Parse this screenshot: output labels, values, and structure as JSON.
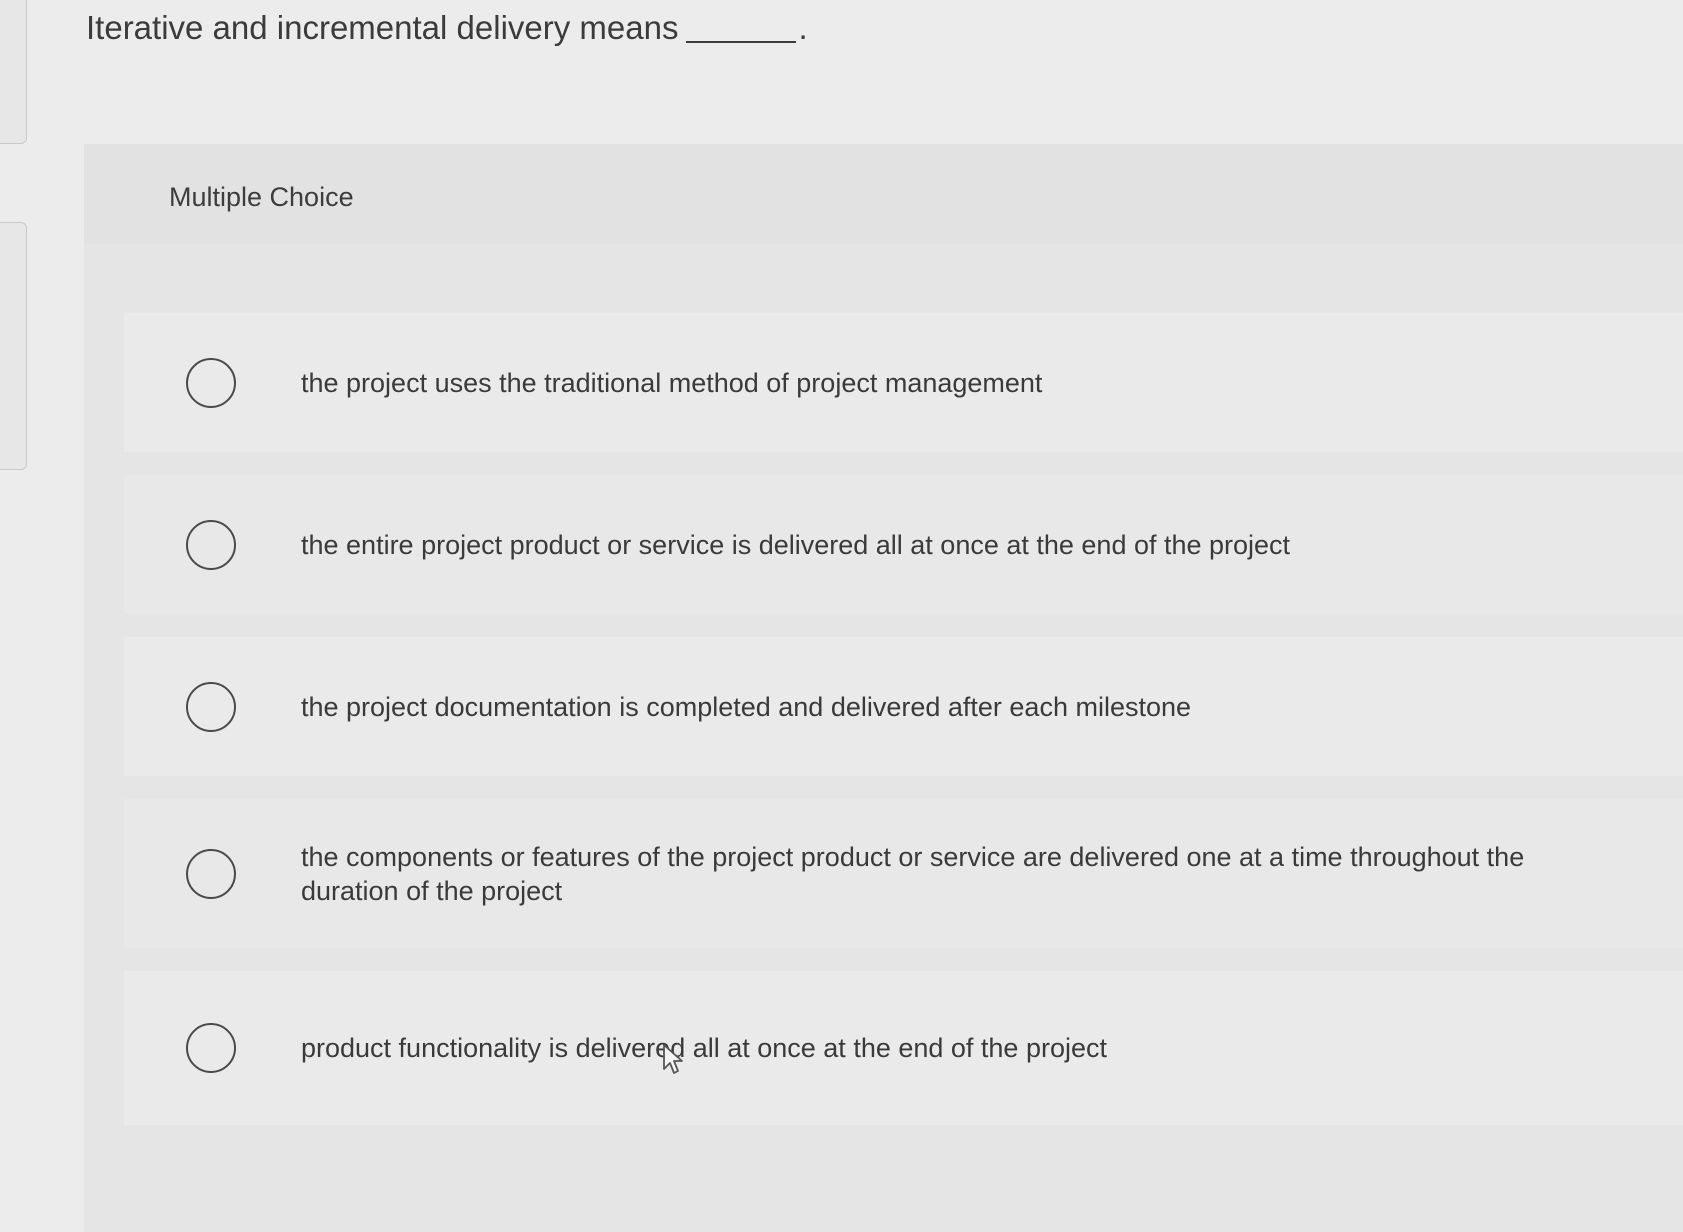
{
  "question": {
    "text": "Iterative and incremental delivery means",
    "blank_suffix": "."
  },
  "section": {
    "label": "Multiple Choice"
  },
  "choices": [
    {
      "label": "the project uses the traditional method of project management",
      "selected": false
    },
    {
      "label": "the entire project product or service is delivered all at once at the end of the project",
      "selected": false
    },
    {
      "label": "the project documentation is completed and delivered after each milestone",
      "selected": false
    },
    {
      "label": "the components or features of the project product or service are delivered one at a time throughout the duration of the project",
      "selected": false
    },
    {
      "label": "product functionality is delivered all at once at the end of the project",
      "selected": false
    }
  ],
  "icons": {
    "radio": "radio-unchecked-icon",
    "cursor": "mouse-pointer-icon"
  },
  "colors": {
    "background": "#ececec",
    "panel": "#e5e5e5",
    "text": "#3a3a3a",
    "radio_border": "#4a4a4a"
  }
}
